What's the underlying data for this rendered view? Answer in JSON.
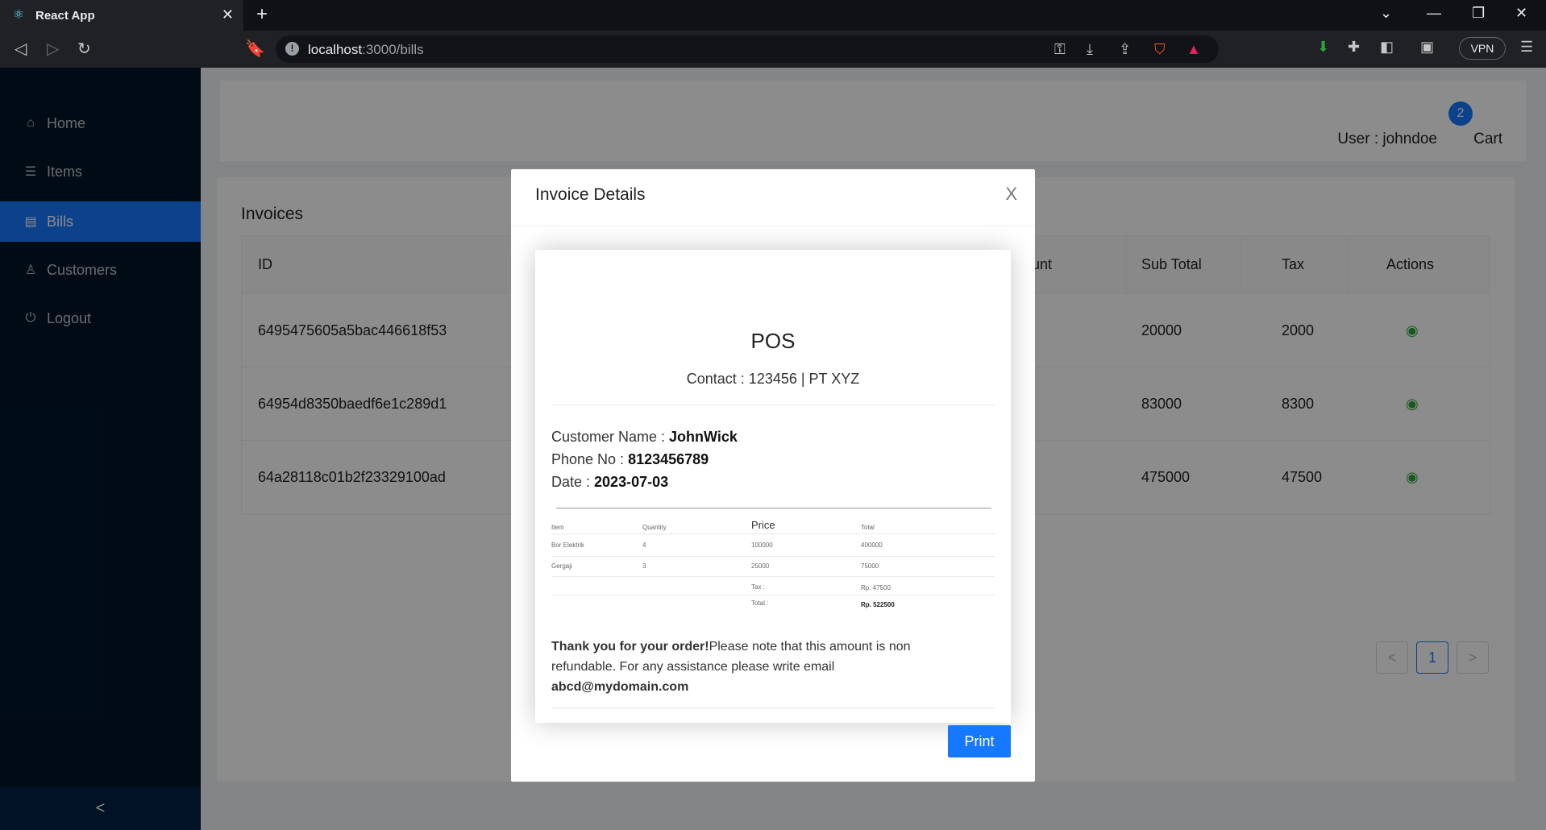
{
  "browser": {
    "tab_title": "React App",
    "url_host": "localhost",
    "url_path": ":3000/bills",
    "vpn_label": "VPN",
    "icons": [
      "react-icon",
      "tab-close-icon",
      "new-tab-icon",
      "back-icon",
      "forward-icon",
      "reload-icon",
      "bookmark-icon",
      "key-icon",
      "download-icon",
      "share-icon",
      "brave-shield-icon",
      "rewards-icon",
      "extensions-icon",
      "sidebar-icon",
      "wallet-icon",
      "menu-icon"
    ]
  },
  "sidebar": {
    "items": [
      {
        "label": "Home",
        "icon": "home-icon"
      },
      {
        "label": "Items",
        "icon": "list-icon"
      },
      {
        "label": "Bills",
        "icon": "bill-icon"
      },
      {
        "label": "Customers",
        "icon": "user-icon"
      },
      {
        "label": "Logout",
        "icon": "logout-icon"
      }
    ],
    "active": "Bills",
    "collapse_glyph": "<"
  },
  "header": {
    "user_text": "User : johndoe",
    "cart_count": "2",
    "cart_label": "Cart"
  },
  "invoices": {
    "title": "Invoices",
    "columns": [
      "ID",
      "unt",
      "Sub Total",
      "Tax",
      "Actions"
    ],
    "rows": [
      {
        "id": "6495475605a5bac446618f53",
        "subtotal": "20000",
        "tax": "2000"
      },
      {
        "id": "64954d8350baedf6e1c289d1",
        "subtotal": "83000",
        "tax": "8300"
      },
      {
        "id": "64a28118c01b2f23329100ad",
        "subtotal": "475000",
        "tax": "47500"
      }
    ],
    "pagination": {
      "prev": "<",
      "current": "1",
      "next": ">"
    }
  },
  "modal": {
    "title": "Invoice Details",
    "close_glyph": "X",
    "invoice": {
      "shop": "POS",
      "contact": "Contact : 123456 | PT XYZ",
      "customer_label": "Customer Name : ",
      "customer_name": "JohnWick",
      "phone_label": "Phone No : ",
      "phone": "8123456789",
      "date_label": "Date : ",
      "date": "2023-07-03",
      "table_headers": [
        "Item",
        "Quantity",
        "Price",
        "Total"
      ],
      "items": [
        {
          "item": "Bor Elektrik",
          "qty": "4",
          "price": "100000",
          "total": "400000"
        },
        {
          "item": "Gergaji",
          "qty": "3",
          "price": "25000",
          "total": "75000"
        }
      ],
      "tax_label": "Tax :",
      "tax_value": "Rp. 47500",
      "total_label": "Total :",
      "total_value": "Rp. 522500",
      "thanks_bold": "Thank you for your order!",
      "thanks_text": "Please note that this amount is non refundable. For any assistance please write email",
      "email": "abcd@mydomain.com"
    },
    "print_label": "Print"
  }
}
